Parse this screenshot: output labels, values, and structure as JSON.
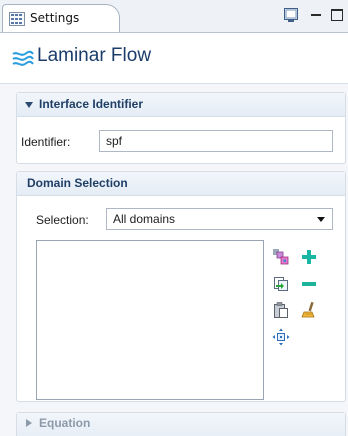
{
  "tab": {
    "label": "Settings",
    "icon": "settings-grid-icon"
  },
  "toolbar_icons": [
    "show-screen-icon",
    "minimize-icon",
    "maximize-icon"
  ],
  "header": {
    "title": "Laminar Flow",
    "icon": "laminar-flow-icon"
  },
  "interface_identifier": {
    "title": "Interface Identifier",
    "expanded": true,
    "identifier_label": "Identifier:",
    "identifier_value": "spf"
  },
  "domain_selection": {
    "title": "Domain Selection",
    "selection_label": "Selection:",
    "selection_value": "All domains",
    "tools": [
      "select-domains-icon",
      "add-icon",
      "move-to-selection-icon",
      "remove-icon",
      "paste-icon",
      "clear-selection-icon",
      "zoom-to-selection-icon"
    ]
  },
  "equation": {
    "title": "Equation",
    "expanded": false
  },
  "colors": {
    "title_blue": "#1c3d6b",
    "add_green": "#19b6a3",
    "remove_green": "#1fb39b"
  }
}
